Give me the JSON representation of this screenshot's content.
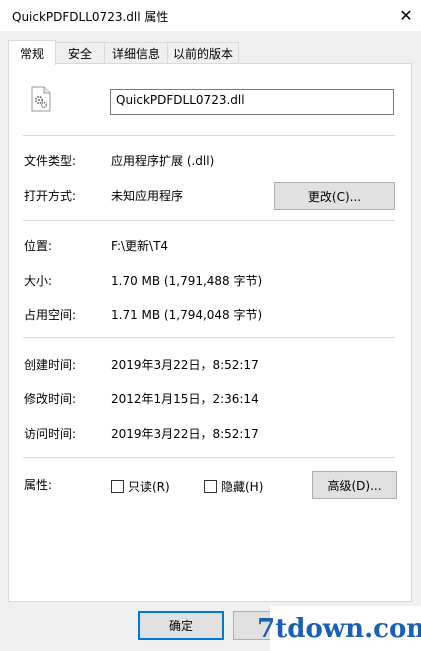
{
  "window": {
    "title": "QuickPDFDLL0723.dll 属性",
    "close_glyph": "✕"
  },
  "tabs": [
    {
      "label": "常规",
      "active": true
    },
    {
      "label": "安全",
      "active": false
    },
    {
      "label": "详细信息",
      "active": false
    },
    {
      "label": "以前的版本",
      "active": false
    }
  ],
  "general": {
    "file_icon": "dll-gear-file-icon",
    "file_name": "QuickPDFDLL0723.dll",
    "file_type_label": "文件类型:",
    "file_type_value": "应用程序扩展 (.dll)",
    "open_with_label": "打开方式:",
    "open_with_value": "未知应用程序",
    "change_button": "更改(C)...",
    "location_label": "位置:",
    "location_value": "F:\\更新\\T4",
    "size_label": "大小:",
    "size_value": "1.70 MB (1,791,488 字节)",
    "size_on_disk_label": "占用空间:",
    "size_on_disk_value": "1.71 MB (1,794,048 字节)",
    "created_label": "创建时间:",
    "created_value": "2019年3月22日，8:52:17",
    "modified_label": "修改时间:",
    "modified_value": "2012年1月15日，2:36:14",
    "accessed_label": "访问时间:",
    "accessed_value": "2019年3月22日，8:52:17",
    "attributes_label": "属性:",
    "readonly_label": "只读(R)",
    "readonly_checked": false,
    "hidden_label": "隐藏(H)",
    "hidden_checked": false,
    "advanced_button": "高级(D)..."
  },
  "footer": {
    "ok_button": "确定",
    "cancel_button": "取"
  },
  "watermark": {
    "text": "7tdown.com"
  },
  "colors": {
    "accent": "#0078d7",
    "watermark": "#1a5fb4"
  }
}
